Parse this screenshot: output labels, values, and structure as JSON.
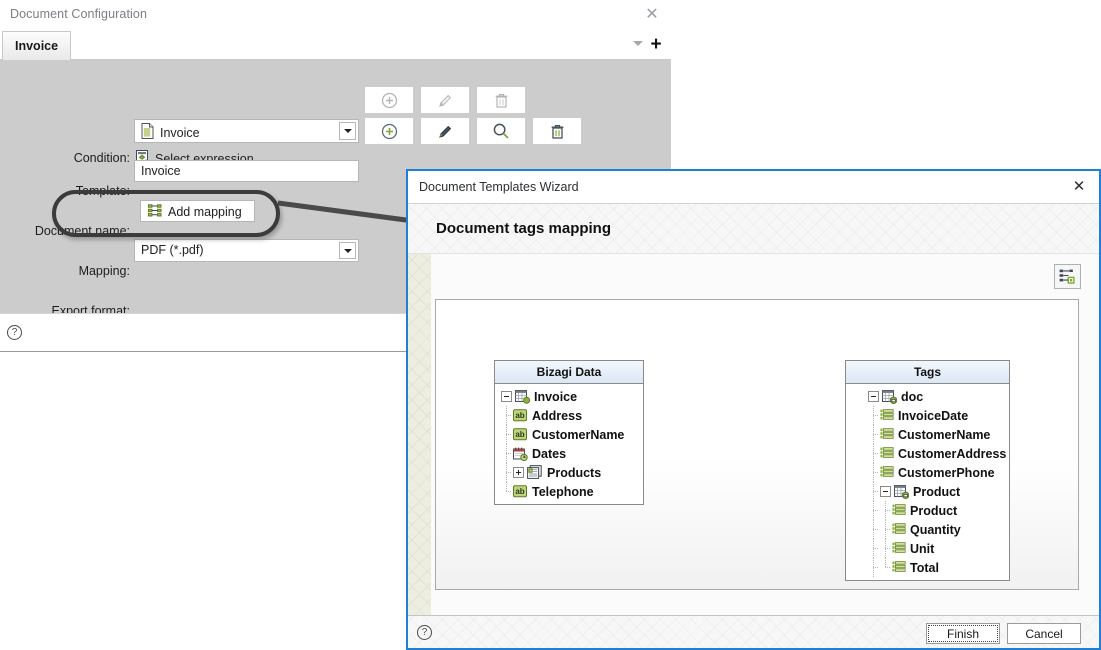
{
  "doc_config": {
    "title": "Document Configuration",
    "close_icon": "close-icon",
    "tabs": [
      {
        "label": "Invoice"
      }
    ],
    "tabs_overflow_icon": "chevron-down-icon",
    "tabs_add_icon": "plus-icon",
    "fields": {
      "condition_label": "Condition:",
      "condition_value": "Select expression",
      "template_label": "Template:",
      "template_value": "Invoice",
      "document_name_label": "Document name:",
      "document_name_value": "Invoice",
      "mapping_label": "Mapping:",
      "mapping_value": "Add mapping",
      "export_format_label": "Export format:",
      "export_format_value": "PDF (*.pdf)"
    },
    "help_icon": "?",
    "row_buttons": {
      "condition": [
        "add-icon",
        "edit-icon",
        "delete-icon"
      ],
      "template": [
        "add-icon",
        "edit-icon",
        "search-icon",
        "delete-icon"
      ]
    }
  },
  "wizard": {
    "title": "Document Templates Wizard",
    "close_icon": "close-icon",
    "heading": "Document tags mapping",
    "toolbar_button": "auto-map-icon",
    "help_icon": "?",
    "buttons": {
      "finish": "Finish",
      "cancel": "Cancel"
    },
    "panels": [
      {
        "id": "bizagi-data",
        "header": "Bizagi Data",
        "nodes": [
          {
            "label": "Invoice",
            "icon": "entity-icon",
            "depth": 0,
            "toggle": "minus",
            "arrow_side": "right"
          },
          {
            "label": "Address",
            "icon": "ab-string-icon",
            "depth": 1,
            "toggle": "none",
            "arrow_side": "right"
          },
          {
            "label": "CustomerName",
            "icon": "ab-string-icon",
            "depth": 1,
            "toggle": "none",
            "arrow_side": "right"
          },
          {
            "label": "Dates",
            "icon": "date-icon",
            "depth": 1,
            "toggle": "none",
            "arrow_side": "right"
          },
          {
            "label": "Products",
            "icon": "collection-icon",
            "depth": 1,
            "toggle": "plus",
            "arrow_side": "right"
          },
          {
            "label": "Telephone",
            "icon": "ab-string-icon",
            "depth": 1,
            "toggle": "none",
            "arrow_side": "right"
          }
        ]
      },
      {
        "id": "tags",
        "header": "Tags",
        "nodes": [
          {
            "label": "doc",
            "icon": "tag-group-icon",
            "depth": 0,
            "toggle": "minus",
            "arrow_side": "left"
          },
          {
            "label": "InvoiceDate",
            "icon": "tag-icon",
            "depth": 1,
            "toggle": "none",
            "arrow_side": "left"
          },
          {
            "label": "CustomerName",
            "icon": "tag-icon",
            "depth": 1,
            "toggle": "none",
            "arrow_side": "left"
          },
          {
            "label": "CustomerAddress",
            "icon": "tag-icon",
            "depth": 1,
            "toggle": "none",
            "arrow_side": "left"
          },
          {
            "label": "CustomerPhone",
            "icon": "tag-icon",
            "depth": 1,
            "toggle": "none",
            "arrow_side": "left"
          },
          {
            "label": "Product",
            "icon": "tag-group-icon",
            "depth": 1,
            "toggle": "minus",
            "arrow_side": "left"
          },
          {
            "label": "Product",
            "icon": "tag-icon",
            "depth": 2,
            "toggle": "none",
            "arrow_side": "left"
          },
          {
            "label": "Quantity",
            "icon": "tag-icon",
            "depth": 2,
            "toggle": "none",
            "arrow_side": "left"
          },
          {
            "label": "Unit",
            "icon": "tag-icon",
            "depth": 2,
            "toggle": "none",
            "arrow_side": "left"
          },
          {
            "label": "Total",
            "icon": "tag-icon",
            "depth": 2,
            "toggle": "none",
            "arrow_side": "left"
          }
        ]
      }
    ]
  },
  "annotation": {
    "shape": "highlight-ellipse",
    "arrow": "callout-arrow",
    "color": "#3b3b3b"
  },
  "colors": {
    "accent_blue": "#1f7fd4",
    "panel_grey": "#cccccc",
    "icon_green": "#8cb23c",
    "icon_dark": "#3f4a54"
  }
}
